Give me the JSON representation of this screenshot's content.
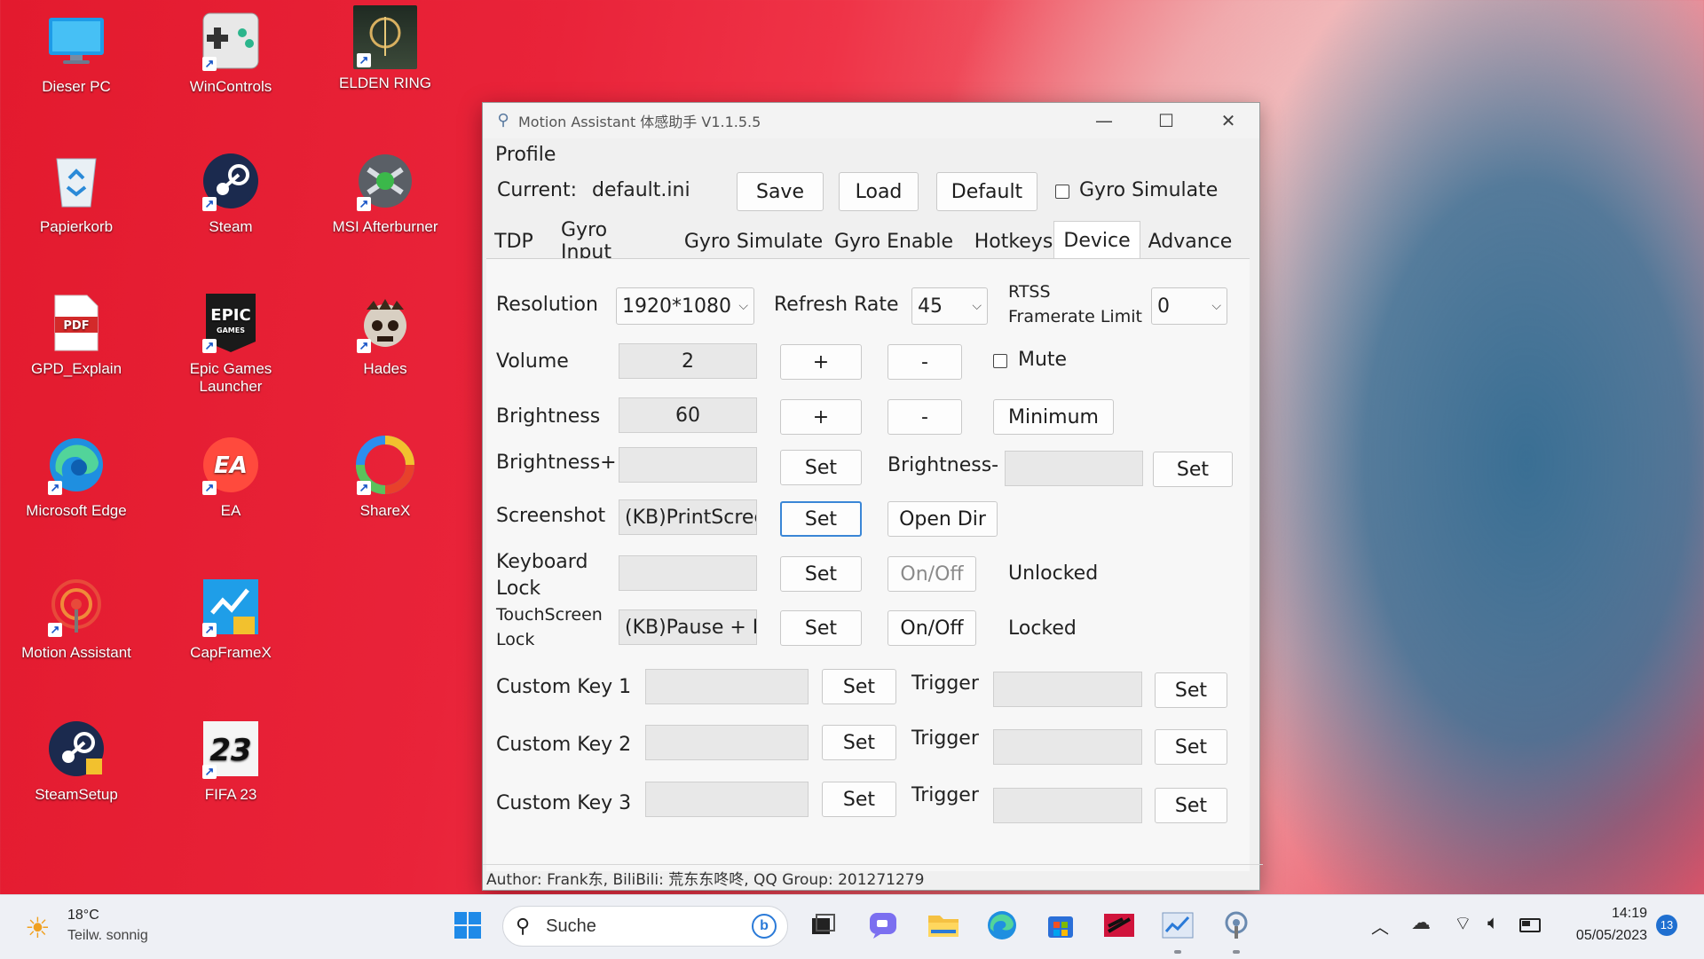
{
  "desktop": {
    "icons": [
      {
        "label": "Dieser PC",
        "icon": "monitor-icon"
      },
      {
        "label": "WinControls",
        "icon": "gamepad-icon"
      },
      {
        "label": "ELDEN RING",
        "icon": "elden-ring-icon"
      },
      {
        "label": "Papierkorb",
        "icon": "recycle-bin-icon"
      },
      {
        "label": "Steam",
        "icon": "steam-icon"
      },
      {
        "label": "MSI Afterburner",
        "icon": "afterburner-icon"
      },
      {
        "label": "GPD_Explain",
        "icon": "pdf-icon"
      },
      {
        "label": "Epic Games Launcher",
        "icon": "epic-games-icon"
      },
      {
        "label": "Hades",
        "icon": "hades-icon"
      },
      {
        "label": "Microsoft Edge",
        "icon": "edge-icon"
      },
      {
        "label": "EA",
        "icon": "ea-icon"
      },
      {
        "label": "ShareX",
        "icon": "sharex-icon"
      },
      {
        "label": "Motion Assistant",
        "icon": "motion-assistant-icon"
      },
      {
        "label": "CapFrameX",
        "icon": "capframex-icon"
      },
      {
        "label": "SteamSetup",
        "icon": "steam-setup-icon"
      },
      {
        "label": "FIFA 23",
        "icon": "fifa-icon"
      }
    ],
    "glyphs": {
      "pdf": "PDF",
      "epic": "EPIC",
      "epic_sub": "GAMES",
      "ea": "EA",
      "fifa": "23"
    }
  },
  "window": {
    "title": "Motion Assistant 体感助手 V1.1.5.5",
    "profile_label": "Profile",
    "current_label": "Current:",
    "current_value": "default.ini",
    "save": "Save",
    "load": "Load",
    "default": "Default",
    "gyro_simulate_check": "Gyro Simulate",
    "tabs": [
      "TDP",
      "Gyro Input",
      "Gyro Simulate",
      "Gyro Enable",
      "Hotkeys",
      "Device",
      "Advance"
    ],
    "active_tab": "Device",
    "device": {
      "resolution_label": "Resolution",
      "resolution_value": "1920*1080",
      "refresh_label": "Refresh Rate",
      "refresh_value": "45",
      "rtss_label_1": "RTSS",
      "rtss_label_2": "Framerate Limit",
      "rtss_value": "0",
      "volume_label": "Volume",
      "volume_value": "2",
      "plus": "+",
      "minus": "-",
      "mute_label": "Mute",
      "brightness_label": "Brightness",
      "brightness_value": "60",
      "minimum": "Minimum",
      "brightness_plus_label": "Brightness+",
      "brightness_minus_label": "Brightness-",
      "set": "Set",
      "screenshot_label": "Screenshot",
      "screenshot_value": "(KB)PrintScree",
      "open_dir": "Open Dir",
      "keyboard_lock_1": "Keyboard",
      "keyboard_lock_2": "Lock",
      "onoff": "On/Off",
      "keyboard_status": "Unlocked",
      "touch_lock_1": "TouchScreen",
      "touch_lock_2": "Lock",
      "touch_value": "(KB)Pause + P",
      "touch_status": "Locked",
      "custom_key_1": "Custom Key 1",
      "custom_key_2": "Custom Key 2",
      "custom_key_3": "Custom Key 3",
      "trigger": "Trigger"
    },
    "footer": "Author:  Frank东,  BiliBili:  荒东东咚咚,  QQ Group:  201271279"
  },
  "taskbar": {
    "weather_temp": "18°C",
    "weather_desc": "Teilw. sonnig",
    "search_placeholder": "Suche",
    "time": "14:19",
    "date": "05/05/2023",
    "notifications": "13"
  }
}
